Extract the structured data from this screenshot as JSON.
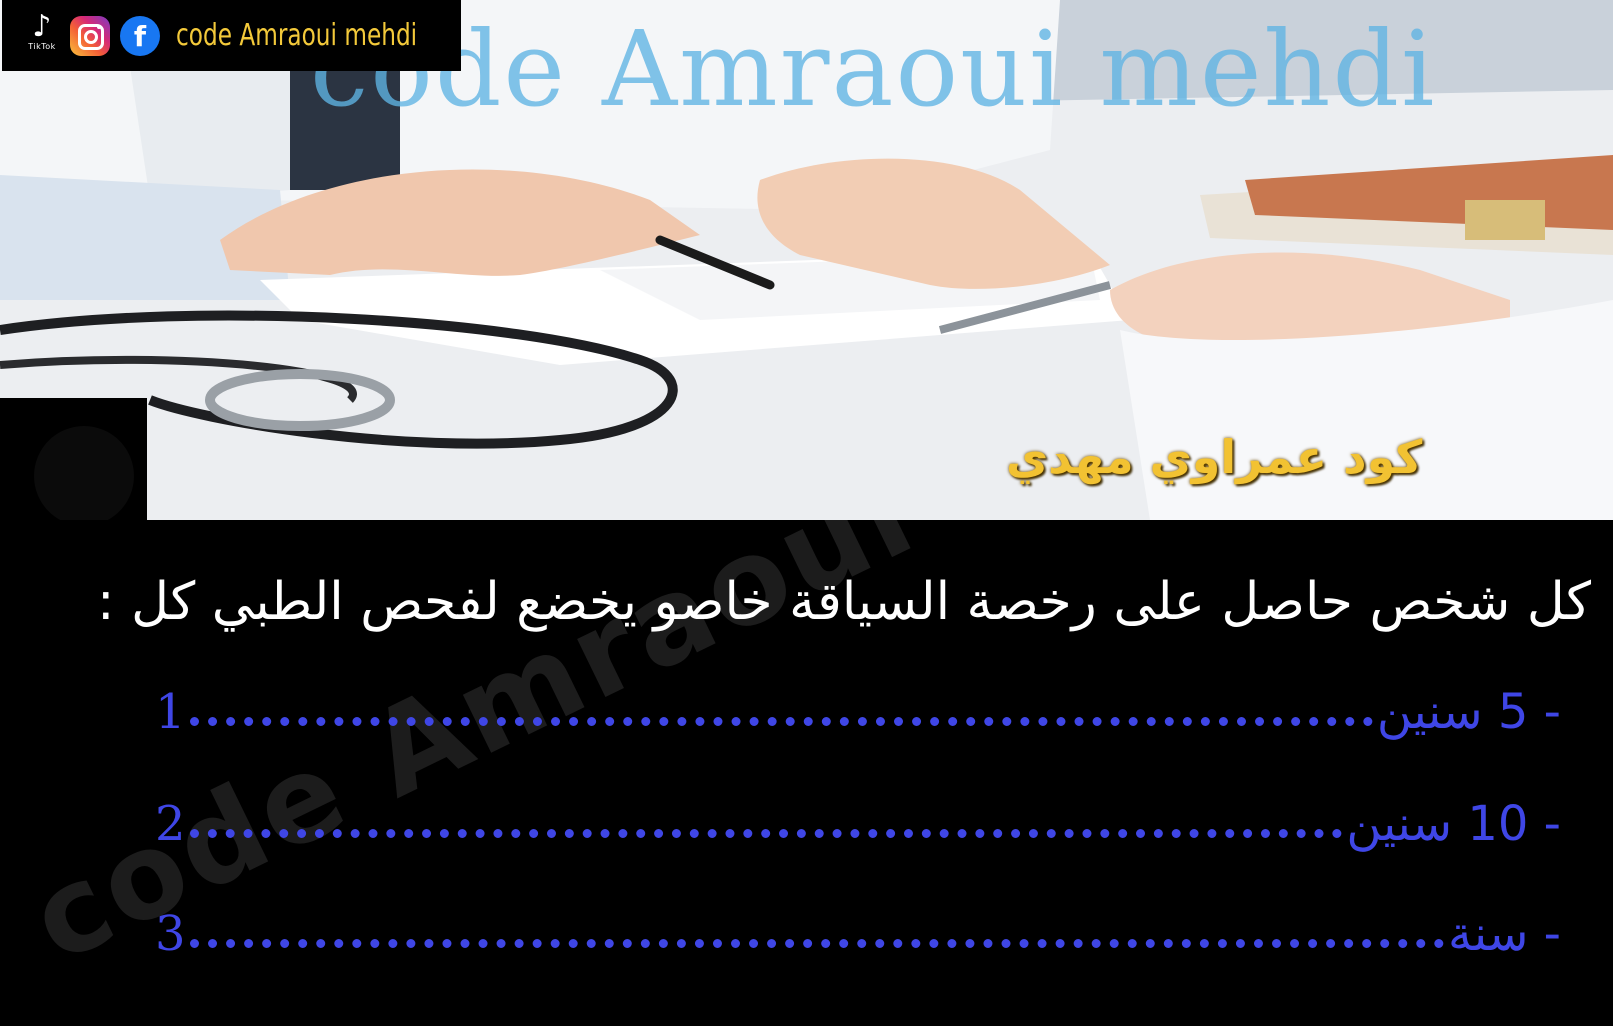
{
  "social_bar": {
    "tiktok_label": "TikTok",
    "channel_name": "code Amraoui mehdi",
    "icons": [
      "tiktok-icon",
      "instagram-icon",
      "facebook-icon"
    ]
  },
  "photo": {
    "watermark": "code Amraoui mehdi",
    "arabic_tag": "كود عمراوي مهدي"
  },
  "question": {
    "text": "كل شخص حاصل على رخصة السياقة خاصو يخضع لفحص الطبي كل :",
    "watermark": "code Amraoui mehdi",
    "answers": [
      {
        "number": "1",
        "text": "- 5  سنين"
      },
      {
        "number": "2",
        "text": "- 10 سنين"
      },
      {
        "number": "3",
        "text": "- سنة"
      }
    ]
  },
  "colors": {
    "answer_blue": "#3f46e6",
    "tag_yellow": "#f2c232",
    "watermark_blue": "#5fb4e4"
  }
}
